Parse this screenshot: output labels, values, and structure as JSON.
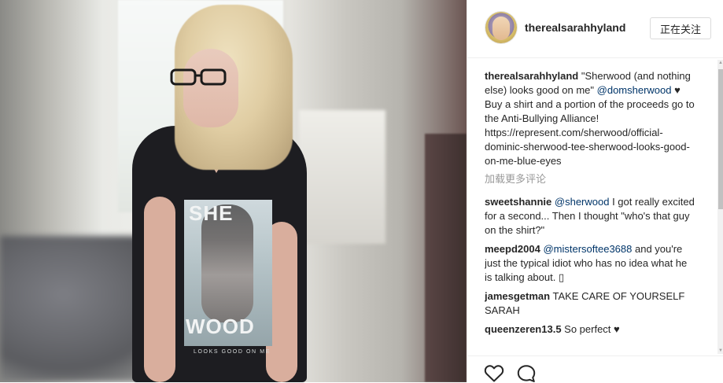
{
  "post": {
    "author": "therealsarahhyland",
    "follow_label": "正在关注",
    "caption": {
      "username": "therealsarahhyland",
      "text_1": " \"Sherwood (and nothing else) looks good on me\" ",
      "mention": "@domsherwood",
      "text_2": " ♥ Buy a shirt and a portion of the proceeds go to the Anti-Bullying Alliance! https://represent.com/sherwood/official-dominic-sherwood-tee-sherwood-looks-good-on-me-blue-eyes"
    },
    "load_more_label": "加载更多评论",
    "comments": [
      {
        "username": "sweetshannie",
        "mention": "@sherwood",
        "text": " I got really excited for a second... Then I thought \"who's that guy on the shirt?\""
      },
      {
        "username": "meepd2004",
        "mention": "@mistersoftee3688",
        "text": " and you're just the typical idiot who has no idea what he is talking about. ▯"
      },
      {
        "username": "jamesgetman",
        "mention": "",
        "text": " TAKE CARE OF YOURSELF SARAH"
      },
      {
        "username": "queenzeren13.5",
        "mention": "",
        "text": " So perfect ♥"
      }
    ]
  },
  "photo": {
    "shirt_print_top": "SHE",
    "shirt_print_bottom": "WOOD",
    "shirt_tagline": "LOOKS GOOD ON ME"
  },
  "icons": {
    "like": "heart-outline-icon",
    "comment": "speech-bubble-icon"
  },
  "colors": {
    "link": "#003569",
    "muted": "#999999",
    "text": "#262626",
    "border": "#efefef"
  }
}
